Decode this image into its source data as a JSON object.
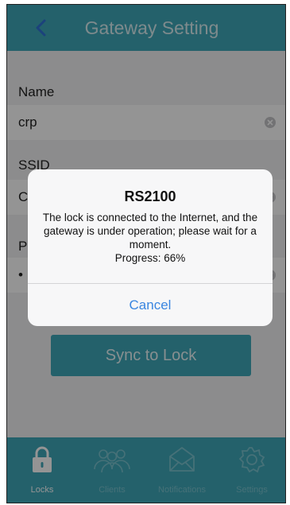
{
  "header": {
    "title": "Gateway Setting"
  },
  "form": {
    "name_label": "Name",
    "name_value": "crp",
    "ssid_label": "SSID",
    "ssid_value": "C",
    "password_label": "P",
    "password_value": "•"
  },
  "sync_button": "Sync to Lock",
  "dialog": {
    "title": "RS2100",
    "message": "The lock is connected to the Internet, and the gateway is under operation; please wait for a moment.",
    "progress": "Progress: 66%",
    "cancel": "Cancel"
  },
  "tabs": [
    {
      "label": "Locks",
      "icon": "lock-icon",
      "active": true
    },
    {
      "label": "Clients",
      "icon": "users-icon",
      "active": false
    },
    {
      "label": "Notifications",
      "icon": "envelope-icon",
      "active": false
    },
    {
      "label": "Settings",
      "icon": "gear-icon",
      "active": false
    }
  ],
  "colors": {
    "accent": "#3fa7b9",
    "link_blue": "#3a86e0",
    "back_arrow": "#2f72d6"
  }
}
